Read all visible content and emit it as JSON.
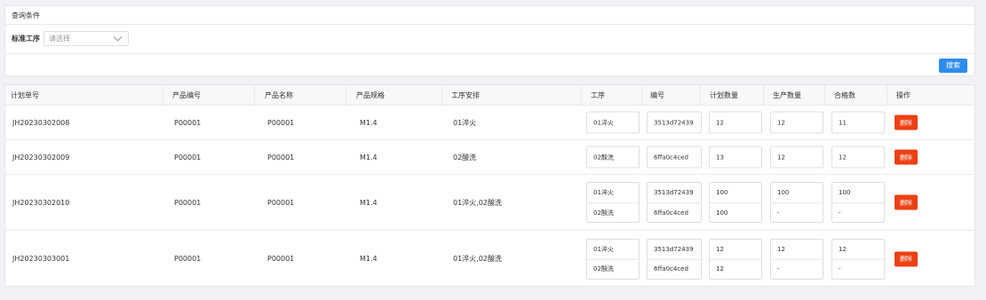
{
  "query": {
    "title": "查询条件",
    "filter_label": "标准工序",
    "select_placeholder": "请选择",
    "search_button": "搜索"
  },
  "table": {
    "headers": [
      "计划单号",
      "产品编号",
      "产品名称",
      "产品规格",
      "工序安排",
      "工序",
      "编号",
      "计划数量",
      "生产数量",
      "合格数",
      "操作"
    ],
    "delete_label": "删除",
    "rows": [
      {
        "plan_no": "JH20230302008",
        "product_code": "P00001",
        "product_name": "P00001",
        "spec": "M1.4",
        "arrangement": "01淬火",
        "steps": [
          {
            "process": "01淬火",
            "code": "3513d72439",
            "planned": "12",
            "produced": "12",
            "qualified": "11"
          }
        ]
      },
      {
        "plan_no": "JH20230302009",
        "product_code": "P00001",
        "product_name": "P00001",
        "spec": "M1.4",
        "arrangement": "02酸洗",
        "steps": [
          {
            "process": "02酸洗",
            "code": "6ffa0c4ced",
            "planned": "13",
            "produced": "12",
            "qualified": "12"
          }
        ]
      },
      {
        "plan_no": "JH20230302010",
        "product_code": "P00001",
        "product_name": "P00001",
        "spec": "M1.4",
        "arrangement": "01淬火,02酸洗",
        "steps": [
          {
            "process": "01淬火",
            "code": "3513d72439",
            "planned": "100",
            "produced": "100",
            "qualified": "100"
          },
          {
            "process": "02酸洗",
            "code": "6ffa0c4ced",
            "planned": "100",
            "produced": "-",
            "qualified": "-"
          }
        ]
      },
      {
        "plan_no": "JH20230303001",
        "product_code": "P00001",
        "product_name": "P00001",
        "spec": "M1.4",
        "arrangement": "01淬火,02酸洗",
        "steps": [
          {
            "process": "01淬火",
            "code": "3513d72439",
            "planned": "12",
            "produced": "12",
            "qualified": "12"
          },
          {
            "process": "02酸洗",
            "code": "6ffa0c4ced",
            "planned": "12",
            "produced": "-",
            "qualified": "-"
          }
        ]
      }
    ]
  }
}
